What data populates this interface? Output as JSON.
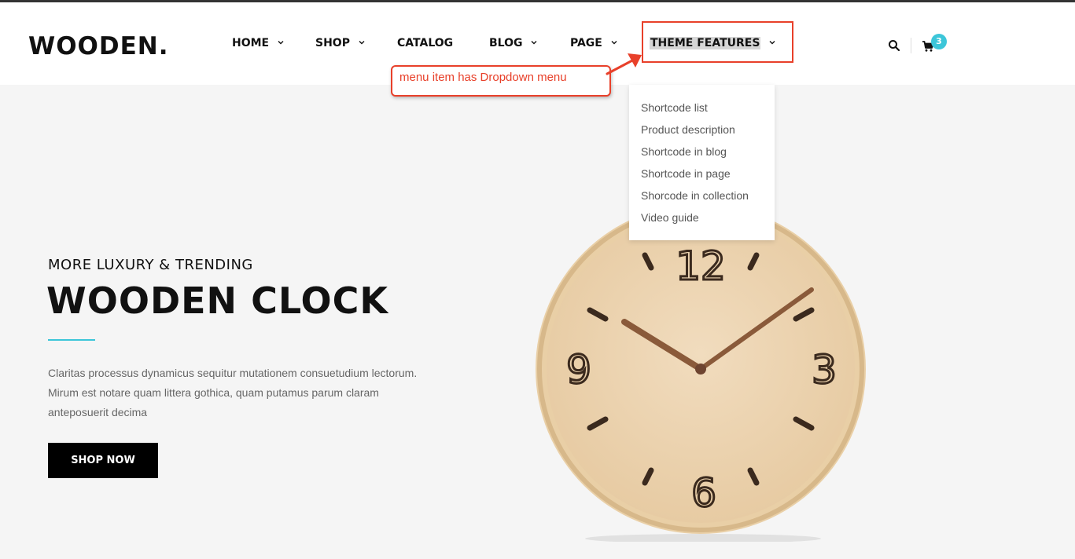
{
  "brand": {
    "logo": "WOODEN."
  },
  "nav": {
    "items": [
      {
        "label": "HOME",
        "has_dropdown": true
      },
      {
        "label": "SHOP",
        "has_dropdown": true
      },
      {
        "label": "CATALOG",
        "has_dropdown": false
      },
      {
        "label": "BLOG",
        "has_dropdown": true
      },
      {
        "label": "PAGE",
        "has_dropdown": true
      },
      {
        "label": "THEME FEATURES",
        "has_dropdown": true,
        "active": true
      }
    ]
  },
  "header_icons": {
    "search": "search-icon",
    "cart": "cart-icon",
    "cart_count": "3"
  },
  "dropdown": {
    "items": [
      "Shortcode list",
      "Product description",
      "Shortcode in blog",
      "Shortcode in page",
      "Shorcode in collection",
      "Video guide"
    ]
  },
  "annotation": {
    "text": "menu item has Dropdown menu",
    "color": "#e8402a"
  },
  "hero": {
    "subtitle": "MORE LUXURY & TRENDING",
    "title": "WOODEN CLOCK",
    "text_lines": [
      "Claritas processus dynamicus sequitur mutationem consuetudium lectorum.",
      "Mirum est notare quam littera gothica, quam putamus parum claram",
      "anteposuerit decima"
    ],
    "button": "SHOP NOW",
    "accent": "#3cc6d9"
  },
  "clock": {
    "numerals": [
      "12",
      "3",
      "6",
      "9"
    ]
  }
}
